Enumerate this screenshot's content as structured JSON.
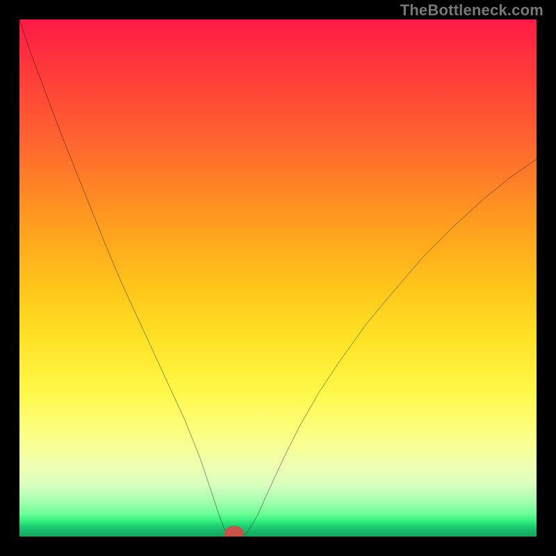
{
  "watermark": "TheBottleneck.com",
  "chart_data": {
    "type": "line",
    "title": "",
    "xlabel": "",
    "ylabel": "",
    "xlim": [
      0,
      100
    ],
    "ylim": [
      0,
      100
    ],
    "grid": false,
    "annotations": [],
    "series": [
      {
        "name": "curve",
        "color": "#000000",
        "x": [
          0,
          2,
          5,
          8,
          11,
          14,
          17,
          20,
          23,
          26,
          29,
          32,
          35,
          37,
          38.5,
          39.5,
          40,
          40.5,
          41,
          42,
          43,
          44,
          46,
          48,
          51,
          54,
          58,
          62,
          67,
          72,
          78,
          84,
          90,
          95,
          100
        ],
        "y": [
          100,
          94,
          86,
          78,
          70.5,
          63,
          55.5,
          48.5,
          42,
          35.5,
          29,
          22.5,
          15,
          9,
          4.5,
          1.7,
          0.4,
          0.1,
          0.1,
          0.1,
          0.1,
          0.7,
          4,
          8.5,
          15,
          21,
          28,
          34,
          41,
          47,
          54,
          60,
          65.5,
          69.5,
          73
        ]
      }
    ],
    "marker": {
      "x": 41.5,
      "y": 0.6,
      "rx": 1.4,
      "ry": 1.0,
      "color": "#c9534b"
    }
  }
}
